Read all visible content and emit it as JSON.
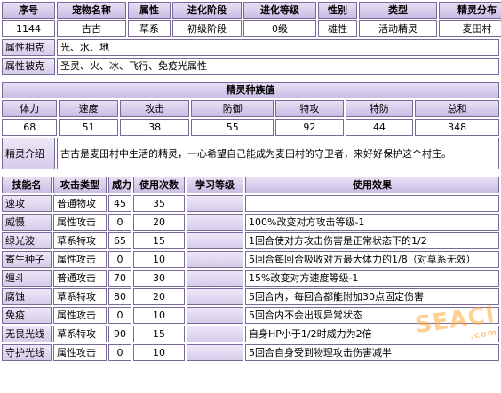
{
  "info_header": [
    "序号",
    "宠物名称",
    "属性",
    "进化阶段",
    "进化等级",
    "性别",
    "类型",
    "精灵分布"
  ],
  "info_values": [
    "1144",
    "古古",
    "草系",
    "初级阶段",
    "0级",
    "雄性",
    "活动精灵",
    "麦田村"
  ],
  "restrain": {
    "label": "属性相克",
    "value": "光、水、地"
  },
  "restrained": {
    "label": "属性被克",
    "value": "圣灵、火、冰、飞行、免疫光属性"
  },
  "race_title": "精灵种族值",
  "race_header": [
    "体力",
    "速度",
    "攻击",
    "防御",
    "特攻",
    "特防",
    "总和"
  ],
  "race_values": [
    "68",
    "51",
    "38",
    "55",
    "92",
    "44",
    "348"
  ],
  "intro": {
    "label": "精灵介绍",
    "text": "古古是麦田村中生活的精灵，一心希望自己能成为麦田村的守卫者，来好好保护这个村庄。"
  },
  "skill_header": [
    "技能名",
    "攻击类型",
    "威力",
    "使用次数",
    "学习等级",
    "使用效果"
  ],
  "skills": [
    {
      "name": "速攻",
      "type": "普通物攻",
      "power": "45",
      "pp": "35",
      "level": "",
      "effect": ""
    },
    {
      "name": "威慑",
      "type": "属性攻击",
      "power": "0",
      "pp": "20",
      "level": "",
      "effect": "100%改变对方攻击等级-1"
    },
    {
      "name": "绿光波",
      "type": "草系特攻",
      "power": "65",
      "pp": "15",
      "level": "",
      "effect": "1回合使对方攻击伤害是正常状态下的1/2"
    },
    {
      "name": "寄生种子",
      "type": "属性攻击",
      "power": "0",
      "pp": "10",
      "level": "",
      "effect": "5回合每回合吸收对方最大体力的1/8（对草系无效）"
    },
    {
      "name": "缠斗",
      "type": "普通攻击",
      "power": "70",
      "pp": "30",
      "level": "",
      "effect": "15%改变对方速度等级-1"
    },
    {
      "name": "腐蚀",
      "type": "草系特攻",
      "power": "80",
      "pp": "20",
      "level": "",
      "effect": "5回合内，每回合都能附加30点固定伤害"
    },
    {
      "name": "免疫",
      "type": "属性攻击",
      "power": "0",
      "pp": "10",
      "level": "",
      "effect": "5回合内不会出现异常状态"
    },
    {
      "name": "无畏光线",
      "type": "草系特攻",
      "power": "90",
      "pp": "15",
      "level": "",
      "effect": "自身HP小于1/2时威力为2倍"
    },
    {
      "name": "守护光线",
      "type": "属性攻击",
      "power": "0",
      "pp": "10",
      "level": "",
      "effect": "5回合自身受到物理攻击伤害减半"
    }
  ],
  "watermark": {
    "text": "SEACI",
    "sub": ".com"
  }
}
